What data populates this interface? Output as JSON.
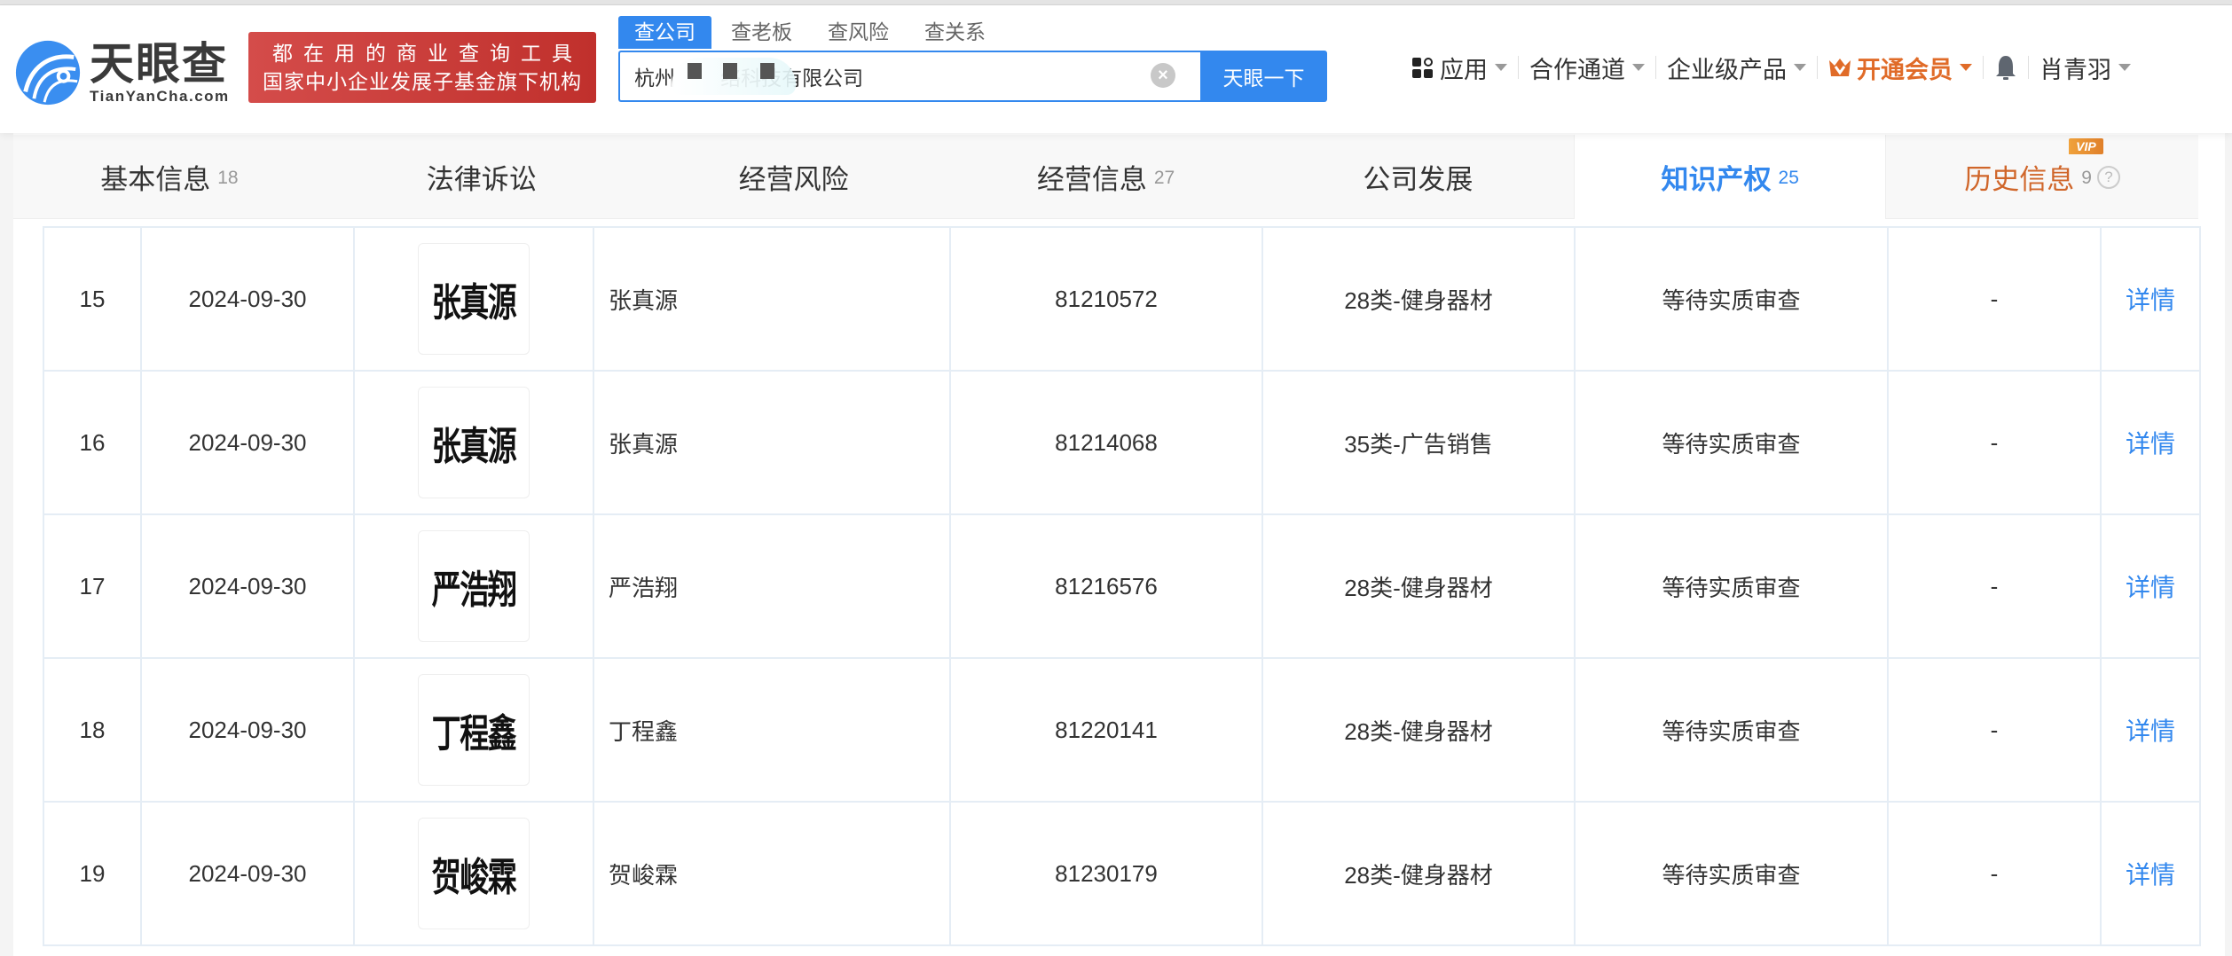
{
  "header": {
    "logo_cn": "天眼查",
    "logo_en": "TianYanCha.com",
    "slogan_line1": "都在用的商业查询工具",
    "slogan_line2": "国家中小企业发展子基金旗下机构",
    "search_tabs": [
      {
        "label": "查公司",
        "active": true
      },
      {
        "label": "查老板",
        "active": false
      },
      {
        "label": "查风险",
        "active": false
      },
      {
        "label": "查关系",
        "active": false
      }
    ],
    "search_value": "杭州        络科技有限公司",
    "search_button": "天眼一下",
    "nav": {
      "apps": "应用",
      "partner": "合作通道",
      "enterprise": "企业级产品",
      "vip": "开通会员",
      "user": "肖青羽"
    }
  },
  "tabs": [
    {
      "label": "基本信息",
      "count": "18"
    },
    {
      "label": "法律诉讼",
      "count": ""
    },
    {
      "label": "经营风险",
      "count": ""
    },
    {
      "label": "经营信息",
      "count": "27"
    },
    {
      "label": "公司发展",
      "count": ""
    },
    {
      "label": "知识产权",
      "count": "25",
      "active": true
    },
    {
      "label": "历史信息",
      "count": "9",
      "badge": "VIP"
    }
  ],
  "trademarks": {
    "rows": [
      {
        "index": "15",
        "date": "2024-09-30",
        "image_text": "张真源",
        "name": "张真源",
        "reg_no": "81210572",
        "class": "28类-健身器材",
        "status": "等待实质审查",
        "extra": "-",
        "action": "详情"
      },
      {
        "index": "16",
        "date": "2024-09-30",
        "image_text": "张真源",
        "name": "张真源",
        "reg_no": "81214068",
        "class": "35类-广告销售",
        "status": "等待实质审查",
        "extra": "-",
        "action": "详情"
      },
      {
        "index": "17",
        "date": "2024-09-30",
        "image_text": "严浩翔",
        "name": "严浩翔",
        "reg_no": "81216576",
        "class": "28类-健身器材",
        "status": "等待实质审查",
        "extra": "-",
        "action": "详情"
      },
      {
        "index": "18",
        "date": "2024-09-30",
        "image_text": "丁程鑫",
        "name": "丁程鑫",
        "reg_no": "81220141",
        "class": "28类-健身器材",
        "status": "等待实质审查",
        "extra": "-",
        "action": "详情"
      },
      {
        "index": "19",
        "date": "2024-09-30",
        "image_text": "贺峻霖",
        "name": "贺峻霖",
        "reg_no": "81230179",
        "class": "28类-健身器材",
        "status": "等待实质审查",
        "extra": "-",
        "action": "详情"
      }
    ]
  },
  "colors": {
    "brand_blue": "#3388ee",
    "vip_orange": "#e06b28",
    "slogan_red": "#c8393a"
  }
}
